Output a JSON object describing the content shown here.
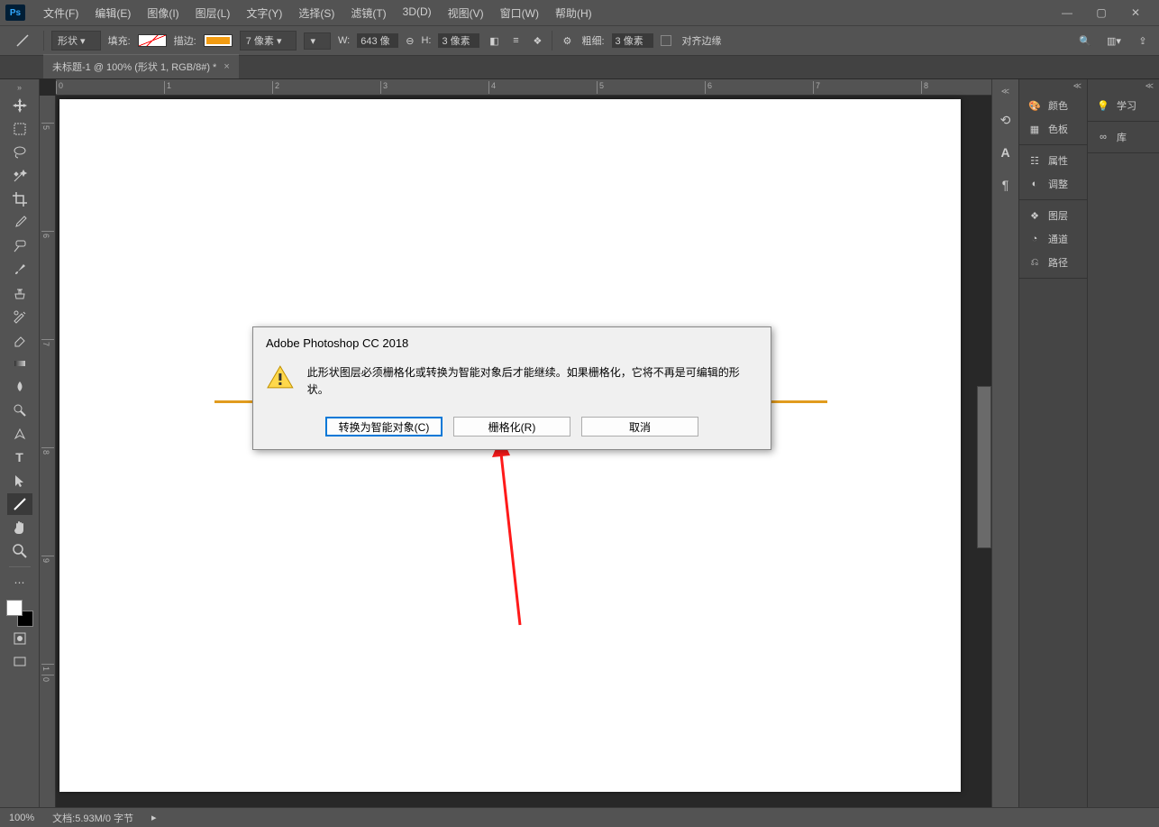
{
  "app": {
    "logo": "Ps"
  },
  "menu": [
    "文件(F)",
    "编辑(E)",
    "图像(I)",
    "图层(L)",
    "文字(Y)",
    "选择(S)",
    "滤镜(T)",
    "3D(D)",
    "视图(V)",
    "窗口(W)",
    "帮助(H)"
  ],
  "opts": {
    "mode": "形状",
    "fill_label": "填充:",
    "stroke_label": "描边:",
    "stroke_px": "7 像素",
    "w_label": "W:",
    "w_val": "643 像",
    "link": "⊖",
    "h_label": "H:",
    "h_val": "3 像素",
    "thickness_label": "粗细:",
    "thickness_val": "3 像素",
    "align_label": "对齐边缘"
  },
  "tab": {
    "title": "未标题-1 @ 100% (形状 1, RGB/8#) *"
  },
  "ruler_h": [
    "0",
    "1",
    "2",
    "3",
    "4",
    "5",
    "6",
    "7",
    "8"
  ],
  "ruler_v": [
    "",
    "5",
    "",
    "6",
    "",
    "7",
    "",
    "8",
    "",
    "9",
    "1",
    "0"
  ],
  "dialog": {
    "title": "Adobe Photoshop CC 2018",
    "message": "此形状图层必须栅格化或转换为智能对象后才能继续。如果栅格化，它将不再是可编辑的形状。",
    "btn_convert": "转换为智能对象(C)",
    "btn_raster": "栅格化(R)",
    "btn_cancel": "取消"
  },
  "panels_left": {
    "color": "颜色",
    "swatches": "色板",
    "properties": "属性",
    "adjustments": "调整",
    "layers": "图层",
    "channels": "通道",
    "paths": "路径"
  },
  "panels_right": {
    "learn": "学习",
    "libraries": "库"
  },
  "status": {
    "zoom": "100%",
    "doc": "文档:5.93M/0 字节"
  }
}
